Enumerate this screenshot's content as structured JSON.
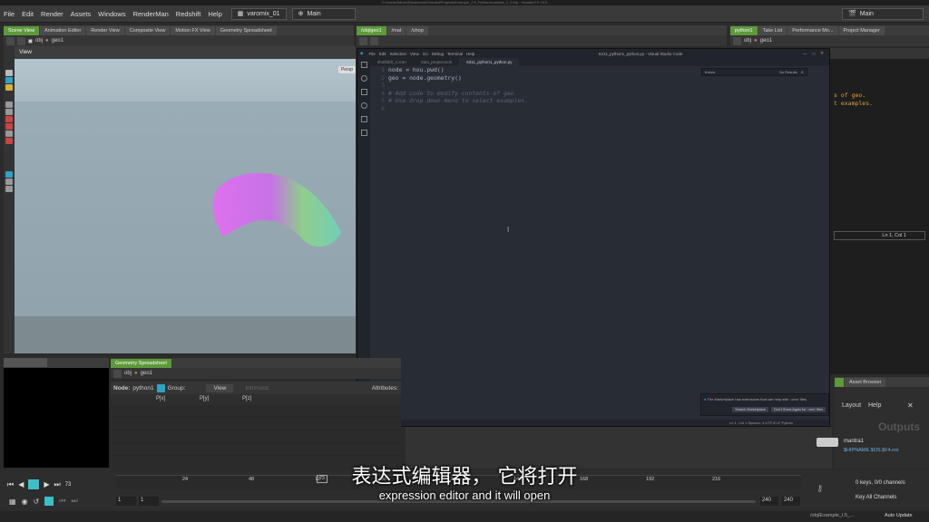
{
  "window_title": "C:/Users/Admin/Documents/Houdini/Projects/Example_2.5_Python/example_2_5.hip - Houdini FX 18.0",
  "menu": [
    "File",
    "Edit",
    "Render",
    "Assets",
    "Windows",
    "RenderMan",
    "Redshift",
    "Help"
  ],
  "desktop_name": "varomix_01",
  "left_context": "Main",
  "right_context": "Main",
  "left_tabs": [
    "Scene View",
    "Animation Editor",
    "Render View",
    "Composite View",
    "Motion FX View",
    "Geometry Spreadsheet"
  ],
  "mid_tabs": [
    "/obj/geo1",
    "/mat",
    "/shop"
  ],
  "right_tabs": [
    "python1",
    "Take List",
    "Performance Mo...",
    "Project Manager"
  ],
  "path": {
    "obj": "obj",
    "geo": "geo1"
  },
  "viewport": {
    "title": "View",
    "persp": "Persp"
  },
  "vscode": {
    "title": "6311_python1_python.py - Visual Studio Code",
    "menu": [
      "File",
      "Edit",
      "Selection",
      "View",
      "Go",
      "Debug",
      "Terminal",
      "Help"
    ],
    "tabs": [
      "shotfoldr_1.icon",
      "Vars_project.icon",
      "6311_python1_python.py"
    ],
    "lines": [
      {
        "n": "1",
        "text": "node = hou.pwd()",
        "comment": false
      },
      {
        "n": "2",
        "text": "geo = node.geometry()",
        "comment": false
      },
      {
        "n": "3",
        "text": "",
        "comment": false
      },
      {
        "n": "4",
        "text": "# Add code to modify contents of geo.",
        "comment": true
      },
      {
        "n": "5",
        "text": "# Use drop down menu to select examples.",
        "comment": true
      },
      {
        "n": "6",
        "text": "",
        "comment": false
      }
    ],
    "find_text": "freeze",
    "find_result": "No Results",
    "notification": "The Marketplace has extensions that can help with '.cnm' files",
    "notif_btn1": "Search Marketplace",
    "notif_btn2": "Don't Show Again for '.cnm' files",
    "status_left": "Activating Extensions...",
    "status_right": "Ln 1, Col 1   Spaces: 4   UTF-8   LF   Python"
  },
  "right_code": {
    "line1": "s of geo.",
    "line2": "t examples.",
    "cursor": "Ln 1, Col 1"
  },
  "spreadsheet": {
    "tab": "Geometry Spreadsheet",
    "node_label": "Node:",
    "node": "python1",
    "group_label": "Group:",
    "view": "View",
    "intrinsics": "Intrinsics",
    "attributes_label": "Attributes:",
    "cols": [
      "P[x]",
      "P[y]",
      "P[z]"
    ]
  },
  "right_bottom": {
    "tab": "Asset Browser",
    "layout": "Layout",
    "help": "Help",
    "outputs": "Outputs",
    "node": "mantra1",
    "node_path": "$HIPNAME.$OS.$F4.exr"
  },
  "timeline": {
    "frame": "73",
    "start": "1",
    "start2": "1",
    "end": "240",
    "end2": "240",
    "ticks": [
      "24",
      "48",
      "72",
      "96",
      "120",
      "144",
      "168",
      "192",
      "216"
    ],
    "keys": "0 keys, 0/0 channels",
    "key_all": "Key All Channels",
    "path": "/obj/Example_I.5_...",
    "auto_update": "Auto Update"
  },
  "subtitles": {
    "cn": "表达式编辑器， 它将打开",
    "en": "expression editor and it will open"
  }
}
